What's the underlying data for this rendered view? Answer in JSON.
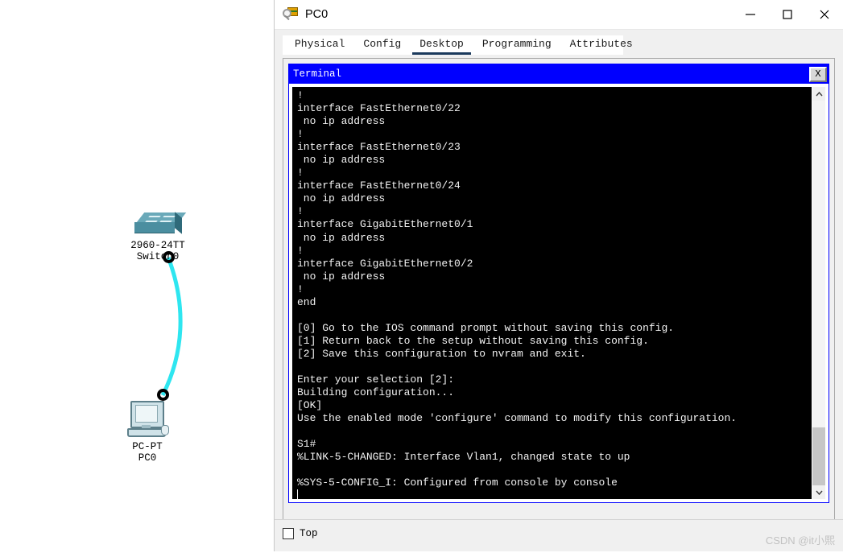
{
  "window": {
    "title": "PC0",
    "icon": "packet-tracer-icon",
    "controls": {
      "minimize": "minimize-icon",
      "maximize": "maximize-icon",
      "close": "close-icon"
    }
  },
  "tabs": [
    {
      "label": "Physical",
      "active": false
    },
    {
      "label": "Config",
      "active": false
    },
    {
      "label": "Desktop",
      "active": true
    },
    {
      "label": "Programming",
      "active": false
    },
    {
      "label": "Attributes",
      "active": false
    }
  ],
  "terminal": {
    "title": "Terminal",
    "close_label": "X",
    "accent_color": "#0000ff",
    "background_color": "#000000",
    "text_color": "#f2f2f2",
    "lines": [
      "!",
      "interface FastEthernet0/22",
      " no ip address",
      "!",
      "interface FastEthernet0/23",
      " no ip address",
      "!",
      "interface FastEthernet0/24",
      " no ip address",
      "!",
      "interface GigabitEthernet0/1",
      " no ip address",
      "!",
      "interface GigabitEthernet0/2",
      " no ip address",
      "!",
      "end",
      "",
      "[0] Go to the IOS command prompt without saving this config.",
      "[1] Return back to the setup without saving this config.",
      "[2] Save this configuration to nvram and exit.",
      "",
      "Enter your selection [2]:",
      "Building configuration...",
      "[OK]",
      "Use the enabled mode 'configure' command to modify this configuration.",
      "",
      "S1#",
      "%LINK-5-CHANGED: Interface Vlan1, changed state to up",
      "",
      "%SYS-5-CONFIG_I: Configured from console by console"
    ],
    "scrollbar": {
      "up_arrow": "chevron-up-icon",
      "down_arrow": "chevron-down-icon"
    }
  },
  "footer": {
    "top_checkbox_label": "Top",
    "top_checked": false,
    "watermark": "CSDN @it小熙"
  },
  "topology": {
    "cable_color": "#2ee6f0",
    "devices": [
      {
        "name": "switch",
        "model": "2960-24TT",
        "label": "Switch0",
        "icon": "switch-icon"
      },
      {
        "name": "pc",
        "model": "PC-PT",
        "label": "PC0",
        "icon": "pc-icon"
      }
    ]
  }
}
